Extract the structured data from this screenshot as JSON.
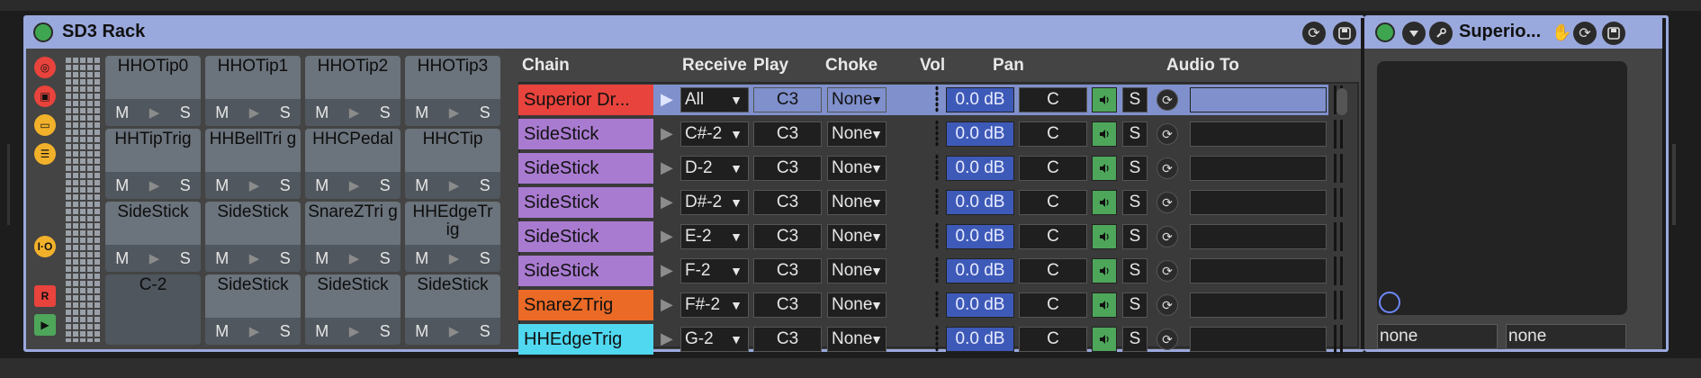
{
  "rack": {
    "title": "SD3 Rack",
    "accent": "#9aa9dd",
    "side_icons": [
      "chain-icon",
      "macro-icon",
      "device-icon",
      "list-icon",
      "io-icon",
      "r-icon",
      "play-icon"
    ],
    "io_label": "I·O",
    "r_label": "R"
  },
  "pads": [
    {
      "label": "HHOTip0",
      "m": "M",
      "s": "S"
    },
    {
      "label": "HHOTip1",
      "m": "M",
      "s": "S"
    },
    {
      "label": "HHOTip2",
      "m": "M",
      "s": "S"
    },
    {
      "label": "HHOTip3",
      "m": "M",
      "s": "S"
    },
    {
      "label": "HHTipTrig",
      "m": "M",
      "s": "S"
    },
    {
      "label": "HHBellTri g",
      "m": "M",
      "s": "S"
    },
    {
      "label": "HHCPedal",
      "m": "M",
      "s": "S"
    },
    {
      "label": "HHCTip",
      "m": "M",
      "s": "S"
    },
    {
      "label": "SideStick",
      "m": "M",
      "s": "S"
    },
    {
      "label": "SideStick",
      "m": "M",
      "s": "S"
    },
    {
      "label": "SnareZTri g",
      "m": "M",
      "s": "S"
    },
    {
      "label": "HHEdgeTr ig",
      "m": "M",
      "s": "S"
    },
    {
      "label": "C-2",
      "m": "",
      "s": ""
    },
    {
      "label": "SideStick",
      "m": "M",
      "s": "S"
    },
    {
      "label": "SideStick",
      "m": "M",
      "s": "S"
    },
    {
      "label": "SideStick",
      "m": "M",
      "s": "S"
    }
  ],
  "headers": {
    "chain": "Chain",
    "receive": "Receive",
    "play": "Play",
    "choke": "Choke",
    "vol": "Vol",
    "pan": "Pan",
    "audio_to": "Audio To"
  },
  "chains": [
    {
      "name": "Superior Dr...",
      "color": "#e8433c",
      "receive": "All",
      "play": "C3",
      "choke": "None",
      "vol": "0.0 dB",
      "pan": "C",
      "solo": "S",
      "selected": true
    },
    {
      "name": "SideStick",
      "color": "#a97bd0",
      "receive": "C#-2",
      "play": "C3",
      "choke": "None",
      "vol": "0.0 dB",
      "pan": "C",
      "solo": "S"
    },
    {
      "name": "SideStick",
      "color": "#a97bd0",
      "receive": "D-2",
      "play": "C3",
      "choke": "None",
      "vol": "0.0 dB",
      "pan": "C",
      "solo": "S"
    },
    {
      "name": "SideStick",
      "color": "#a97bd0",
      "receive": "D#-2",
      "play": "C3",
      "choke": "None",
      "vol": "0.0 dB",
      "pan": "C",
      "solo": "S"
    },
    {
      "name": "SideStick",
      "color": "#a97bd0",
      "receive": "E-2",
      "play": "C3",
      "choke": "None",
      "vol": "0.0 dB",
      "pan": "C",
      "solo": "S"
    },
    {
      "name": "SideStick",
      "color": "#a97bd0",
      "receive": "F-2",
      "play": "C3",
      "choke": "None",
      "vol": "0.0 dB",
      "pan": "C",
      "solo": "S"
    },
    {
      "name": "SnareZTrig",
      "color": "#ea6a26",
      "receive": "F#-2",
      "play": "C3",
      "choke": "None",
      "vol": "0.0 dB",
      "pan": "C",
      "solo": "S"
    },
    {
      "name": "HHEdgeTrig",
      "color": "#4fd8f0",
      "receive": "G-2",
      "play": "C3",
      "choke": "None",
      "vol": "0.0 dB",
      "pan": "C",
      "solo": "S"
    }
  ],
  "plugin": {
    "title": "Superio...",
    "x_select": "none",
    "y_select": "none"
  }
}
